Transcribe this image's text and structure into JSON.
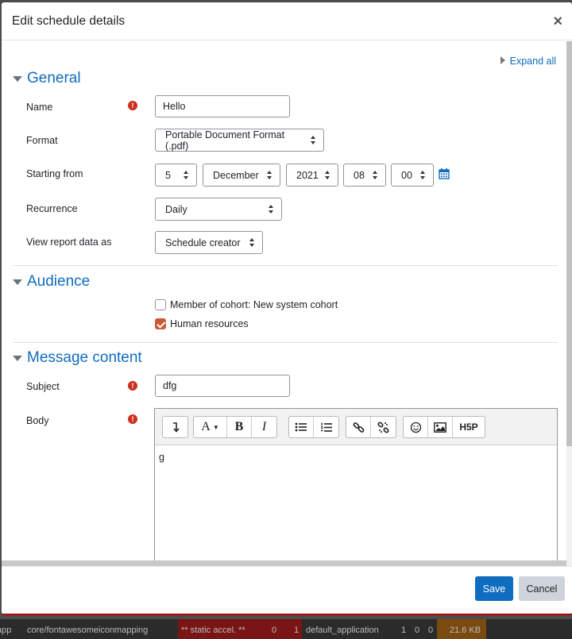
{
  "modal": {
    "title": "Edit schedule details",
    "close_glyph": "×",
    "expand_all": "Expand all"
  },
  "general": {
    "title": "General",
    "name_label": "Name",
    "name_value": "Hello",
    "format_label": "Format",
    "format_value": "Portable Document Format (.pdf)",
    "starting_label": "Starting from",
    "day": "5",
    "month": "December",
    "year": "2021",
    "hour": "08",
    "minute": "00",
    "recurrence_label": "Recurrence",
    "recurrence_value": "Daily",
    "view_as_label": "View report data as",
    "view_as_value": "Schedule creator"
  },
  "audience": {
    "title": "Audience",
    "options": [
      {
        "label": "Member of cohort: New system cohort",
        "checked": false
      },
      {
        "label": "Human resources",
        "checked": true
      }
    ]
  },
  "message": {
    "title": "Message content",
    "subject_label": "Subject",
    "subject_value": "dfg",
    "body_label": "Body",
    "body_value": "g",
    "toolbar": {
      "font_label": "A",
      "bold": "B",
      "italic": "I",
      "h5p": "H5P"
    }
  },
  "footer": {
    "save": "Save",
    "cancel": "Cancel"
  },
  "perfbar": {
    "app": "app",
    "mapping": "core/fontawesomeiconmapping",
    "static": "** static accel. **",
    "n0": "0",
    "n1": "1",
    "default_app": "default_application",
    "c1": "1",
    "c2": "0",
    "c3": "0",
    "size": "21.6 KB"
  },
  "colors": {
    "accent": "#0f6cbf",
    "required": "#ca3120",
    "checkbox_checked": "#ca5a36"
  }
}
